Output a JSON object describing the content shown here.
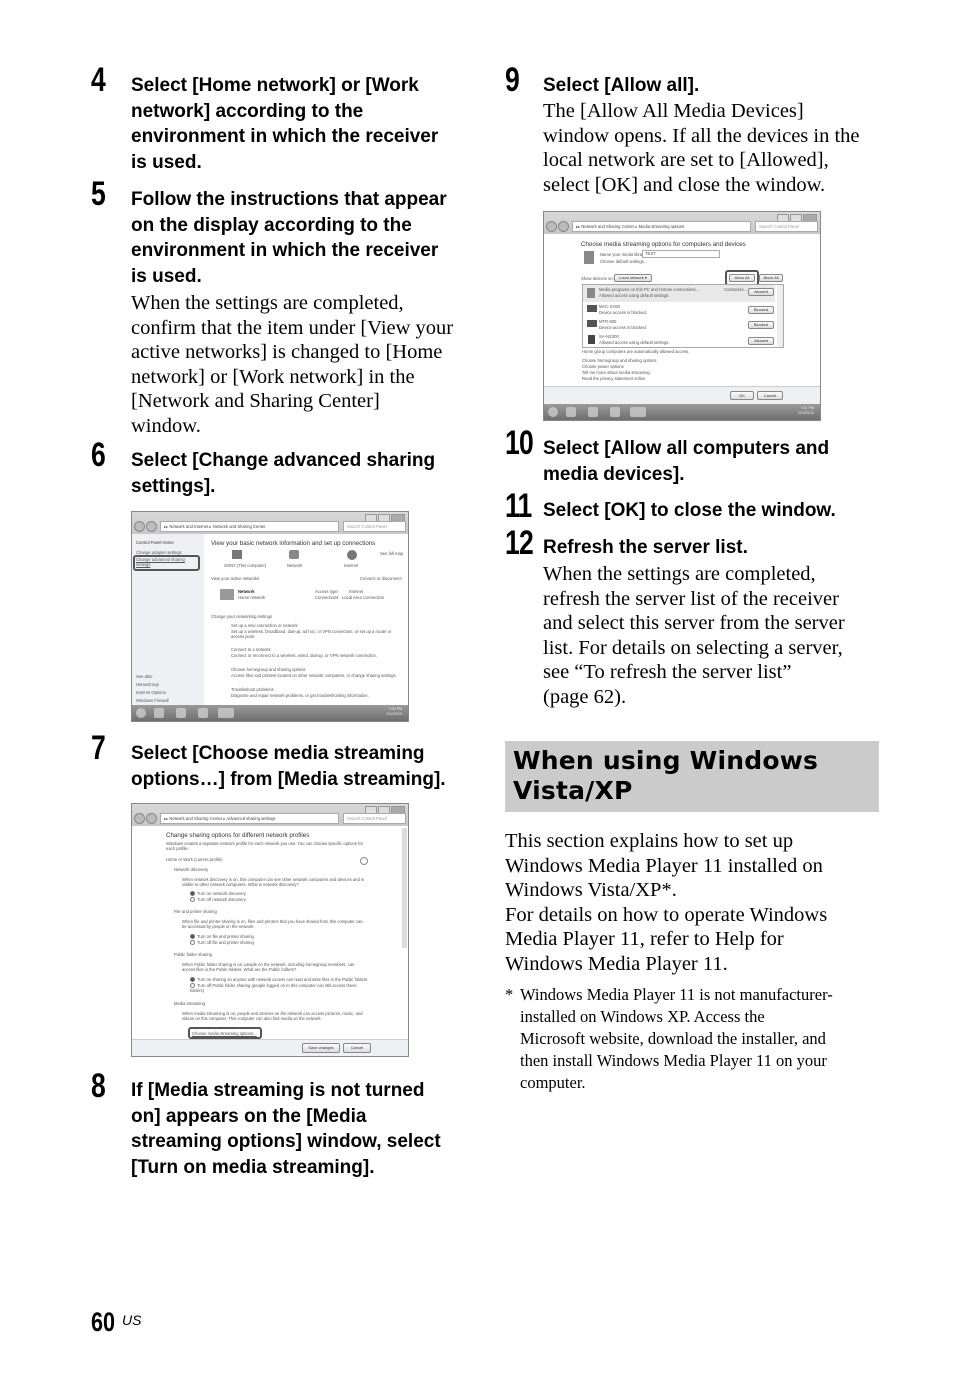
{
  "page": {
    "number": "60",
    "region_suffix": "US"
  },
  "left_column": {
    "steps": [
      {
        "num": "4",
        "title_lines": [
          "Select [Home network] or [Work",
          "network] according to the",
          "environment in which the receiver",
          "is used."
        ]
      },
      {
        "num": "5",
        "title_lines": [
          "Follow the instructions that appear",
          "on the display according to the",
          "environment in which the receiver",
          "is used."
        ],
        "body_lines": [
          "When the settings are completed,",
          "confirm that the item under [View your",
          "active networks] is changed to [Home",
          "network] or [Work network] in the",
          "[Network and Sharing Center]",
          "window."
        ]
      },
      {
        "num": "6",
        "title_lines": [
          "Select [Change advanced sharing",
          "settings]."
        ]
      },
      {
        "num": "7",
        "title_lines": [
          "Select [Choose media streaming",
          "options…] from [Media streaming]."
        ]
      },
      {
        "num": "8",
        "title_lines": [
          "If [Media streaming is not turned",
          "on] appears on the [Media",
          "streaming options] window, select",
          "[Turn on media streaming]."
        ]
      }
    ]
  },
  "right_column": {
    "steps": [
      {
        "num": "9",
        "title_lines": [
          "Select [Allow all]."
        ],
        "body_lines": [
          "The [Allow All Media Devices]",
          "window opens. If all the devices in the",
          "local network are set to [Allowed],",
          "select [OK] and close the window."
        ]
      },
      {
        "num": "10",
        "title_lines": [
          "Select [Allow all computers and",
          "media devices]."
        ]
      },
      {
        "num": "11",
        "title_lines": [
          "Select [OK] to close the window."
        ]
      },
      {
        "num": "12",
        "title_lines": [
          "Refresh the server list."
        ],
        "body_lines": [
          "When the settings are completed,",
          "refresh the server list of the receiver",
          "and select this server from the server",
          "list. For details on selecting a server,",
          "see “To refresh the server list”",
          "(page 62)."
        ]
      }
    ],
    "section": {
      "heading_lines": [
        "When using Windows",
        "Vista/XP"
      ],
      "body_lines": [
        "This section explains how to set up",
        "Windows Media Player 11 installed on",
        "Windows Vista/XP*.",
        "For details on how to operate Windows",
        "Media Player 11, refer to Help for",
        "Windows Media Player 11."
      ],
      "footnote_marker": "*",
      "footnote_lines": [
        "Windows Media Player 11 is not manufacturer-",
        "installed on Windows XP. Access the",
        "Microsoft website, download the installer, and",
        "then install Windows Media Player 11 on your",
        "computer."
      ]
    }
  },
  "screenshots": {
    "network_center": {
      "address": "▸▸ Network and Internet ▸ Network and Sharing Center",
      "search_placeholder": "Search Control Panel",
      "sidebar": [
        "Control Panel Home",
        "Change adapter settings",
        "Change advanced sharing settings"
      ],
      "see_also": [
        "See also",
        "HomeGroup",
        "Internet Options",
        "Windows Firewall"
      ],
      "heading": "View your basic network information and set up connections",
      "see_full_map": "See full map",
      "map_nodes": [
        "SONY (This computer)",
        "Network",
        "Internet"
      ],
      "active_networks_label": "View your active networks",
      "connect_disconnect": "Connect or disconnect",
      "network_name": "Network",
      "network_type": "Home network",
      "access_type_label": "Access type:",
      "access_type_value": "Internet",
      "connections_label": "Connections:",
      "connections_value": "Local Area Connection",
      "change_settings_label": "Change your networking settings",
      "tasks": [
        {
          "title": "Set up a new connection or network",
          "desc": "Set up a wireless, broadband, dial-up, ad hoc, or VPN connection; or set up a router or access point."
        },
        {
          "title": "Connect to a network",
          "desc": "Connect or reconnect to a wireless, wired, dial-up, or VPN network connection."
        },
        {
          "title": "Choose homegroup and sharing options",
          "desc": "Access files and printers located on other network computers, or change sharing settings."
        },
        {
          "title": "Troubleshoot problems",
          "desc": "Diagnose and repair network problems, or get troubleshooting information."
        }
      ],
      "clock_time": "7:00 PM",
      "clock_date": "1/12/2010"
    },
    "advanced_sharing": {
      "address": "▸▸ Network and Sharing Center ▸ Advanced sharing settings",
      "search_placeholder": "Search Control Panel",
      "heading": "Change sharing options for different network profiles",
      "intro": "Windows creates a separate network profile for each network you use. You can choose specific options for each profile.",
      "profile": "Home or Work (current profile)",
      "groups": [
        {
          "title": "Network discovery",
          "desc": "When network discovery is on, this computer can see other network computers and devices and is visible to other network computers. What is network discovery?",
          "options": [
            "Turn on network discovery",
            "Turn off network discovery"
          ],
          "selected": 0
        },
        {
          "title": "File and printer sharing",
          "desc": "When file and printer sharing is on, files and printers that you have shared from this computer can be accessed by people on the network.",
          "options": [
            "Turn on file and printer sharing",
            "Turn off file and printer sharing"
          ],
          "selected": 0
        },
        {
          "title": "Public folder sharing",
          "desc": "When Public folder sharing is on, people on the network, including homegroup members, can access files in the Public folders. What are the Public folders?",
          "options": [
            "Turn on sharing so anyone with network access can read and write files in the Public folders",
            "Turn off Public folder sharing (people logged on to this computer can still access these folders)"
          ],
          "selected": 0
        },
        {
          "title": "Media streaming",
          "desc": "When media streaming is on, people and devices on the network can access pictures, music, and videos on this computer. This computer can also find media on the network.",
          "link": "Choose media streaming options..."
        }
      ],
      "save_button": "Save changes",
      "cancel_button": "Cancel"
    },
    "media_streaming": {
      "address": "▸▸ Network and Sharing Center ▸ Media streaming options",
      "search_placeholder": "Search Control Panel",
      "heading": "Choose media streaming options for computers and devices",
      "library_label": "Name your media library:",
      "library_value": "TEST",
      "default_settings": "Choose default settings...",
      "show_devices_label": "Show devices on:",
      "show_devices_value": "Local network",
      "allow_all": "Allow All",
      "block_all": "Block All",
      "devices": [
        {
          "name": "Media programs on this PC and remote connections...",
          "desc": "Allowed access using default settings.",
          "customize": "Customize...",
          "status": "Allowed"
        },
        {
          "name": "MAC-SV50",
          "desc": "Device access is blocked.",
          "status": "Blocked"
        },
        {
          "name": "MTR-505",
          "desc": "Device access is blocked.",
          "status": "Blocked"
        },
        {
          "name": "SA-NS300",
          "desc": "Allowed access using default settings.",
          "status": "Allowed"
        }
      ],
      "homegroup_note": "Home group computers are automatically allowed access.",
      "links": [
        "Choose homegroup and sharing options",
        "Choose power options",
        "Tell me more about media streaming",
        "Read the privacy statement online"
      ],
      "ok_button": "OK",
      "cancel_button": "Cancel",
      "clock_time": "7:41 PM",
      "clock_date": "1/12/2010"
    }
  }
}
